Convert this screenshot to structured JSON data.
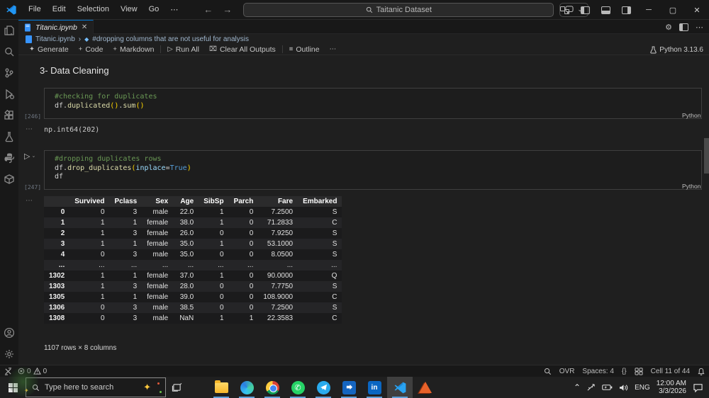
{
  "title_bar": {
    "menus": [
      "File",
      "Edit",
      "Selection",
      "View",
      "Go",
      "⋯"
    ],
    "back_arrow": "←",
    "forward_arrow": "→",
    "search_value": "Taitanic Dataset",
    "minimize": "─",
    "maximize": "▢",
    "close": "✕",
    "copilot_chevron": "⌄"
  },
  "editor_tabs": {
    "active_tab": "Titanic.ipynb",
    "close_glyph": "✕",
    "gear": "⚙",
    "more": "⋯"
  },
  "breadcrumb": {
    "file": "Titanic.ipynb",
    "separator": "›",
    "cell_label": "#dropping columns that are not useful for analysis"
  },
  "notebook_toolbar": {
    "items": [
      {
        "icon": "sparkle-icon",
        "label": "Generate",
        "sep_before": false
      },
      {
        "icon": "plus-icon",
        "label": "Code",
        "sep_before": false
      },
      {
        "icon": "plus-icon",
        "label": "Markdown",
        "sep_before": false
      },
      {
        "icon": "play-icon",
        "label": "Run All",
        "sep_before": true
      },
      {
        "icon": "clear-icon",
        "label": "Clear All Outputs",
        "sep_before": false
      },
      {
        "icon": "outline-icon",
        "label": "Outline",
        "sep_before": true
      },
      {
        "icon": "more-icon",
        "label": "",
        "sep_before": false
      }
    ],
    "icon_glyphs": {
      "sparkle-icon": "✦",
      "plus-icon": "+",
      "play-icon": "▷",
      "clear-icon": "⌧",
      "outline-icon": "≡",
      "more-icon": "⋯"
    },
    "kernel_label": "Python 3.13.6"
  },
  "notebook": {
    "heading": "3- Data Cleaning",
    "cells": [
      {
        "exec_label": "[246]",
        "lang": "Python",
        "output_dots": "⋯",
        "code": [
          [
            {
              "c": "comment",
              "t": "#checking for duplicates"
            }
          ],
          [
            {
              "c": "plain",
              "t": "df"
            },
            {
              "c": "op",
              "t": "."
            },
            {
              "c": "func",
              "t": "duplicated"
            },
            {
              "c": "paren",
              "t": "()"
            },
            {
              "c": "op",
              "t": "."
            },
            {
              "c": "func",
              "t": "sum"
            },
            {
              "c": "paren",
              "t": "()"
            }
          ]
        ]
      },
      {
        "exec_label": "[247]",
        "lang": "Python",
        "output_dots": "⋯",
        "run_glyph": "▷",
        "run_chevron": "⌄",
        "code": [
          [
            {
              "c": "comment",
              "t": "#dropping duplicates rows"
            }
          ],
          [
            {
              "c": "plain",
              "t": "df"
            },
            {
              "c": "op",
              "t": "."
            },
            {
              "c": "func",
              "t": "drop_duplicates"
            },
            {
              "c": "paren",
              "t": "("
            },
            {
              "c": "param",
              "t": "inplace"
            },
            {
              "c": "op",
              "t": "="
            },
            {
              "c": "kw",
              "t": "True"
            },
            {
              "c": "paren",
              "t": ")"
            }
          ],
          [
            {
              "c": "plain",
              "t": "df"
            }
          ]
        ]
      }
    ],
    "output_scalar": "np.int64(202)",
    "dataframe": {
      "columns": [
        "",
        "Survived",
        "Pclass",
        "Sex",
        "Age",
        "SibSp",
        "Parch",
        "Fare",
        "Embarked"
      ],
      "rows": [
        [
          "0",
          "0",
          "3",
          "male",
          "22.0",
          "1",
          "0",
          "7.2500",
          "S"
        ],
        [
          "1",
          "1",
          "1",
          "female",
          "38.0",
          "1",
          "0",
          "71.2833",
          "C"
        ],
        [
          "2",
          "1",
          "3",
          "female",
          "26.0",
          "0",
          "0",
          "7.9250",
          "S"
        ],
        [
          "3",
          "1",
          "1",
          "female",
          "35.0",
          "1",
          "0",
          "53.1000",
          "S"
        ],
        [
          "4",
          "0",
          "3",
          "male",
          "35.0",
          "0",
          "0",
          "8.0500",
          "S"
        ],
        [
          "...",
          "...",
          "...",
          "...",
          "...",
          "...",
          "...",
          "...",
          "..."
        ],
        [
          "1302",
          "1",
          "1",
          "female",
          "37.0",
          "1",
          "0",
          "90.0000",
          "Q"
        ],
        [
          "1303",
          "1",
          "3",
          "female",
          "28.0",
          "0",
          "0",
          "7.7750",
          "S"
        ],
        [
          "1305",
          "1",
          "1",
          "female",
          "39.0",
          "0",
          "0",
          "108.9000",
          "C"
        ],
        [
          "1306",
          "0",
          "3",
          "male",
          "38.5",
          "0",
          "0",
          "7.2500",
          "S"
        ],
        [
          "1308",
          "0",
          "3",
          "male",
          "NaN",
          "1",
          "1",
          "22.3583",
          "C"
        ]
      ],
      "caption": "1107 rows × 8 columns"
    }
  },
  "status_bar": {
    "errors": "0",
    "warnings": "0",
    "overtype": "OVR",
    "spaces": "Spaces: 4",
    "braces": "{}",
    "cell_position": "Cell 11 of 44"
  },
  "taskbar": {
    "search_placeholder": "Type here to search",
    "language": "ENG",
    "time": "12:00 AM",
    "date": "3/3/2026",
    "tray_chevron": "⌃"
  },
  "colors": {
    "accent": "#0078d4",
    "comment": "#6a9955",
    "function": "#dcdcaa",
    "keyword": "#569cd6"
  }
}
